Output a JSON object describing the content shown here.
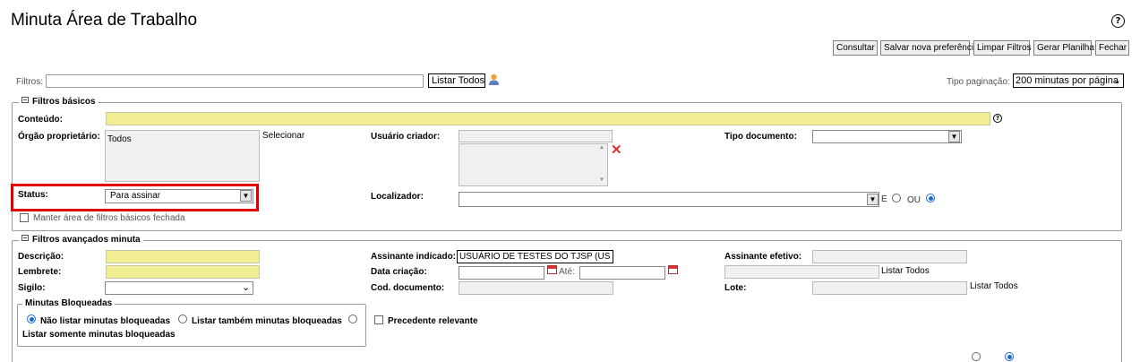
{
  "header": {
    "title": "Minuta Área de Trabalho",
    "help_glyph": "?"
  },
  "toolbar": {
    "consultar": "Consultar",
    "salvar": "Salvar nova preferência",
    "limpar": "Limpar Filtros",
    "gerar": "Gerar Planilha",
    "fechar": "Fechar"
  },
  "filters_bar": {
    "label": "Filtros:",
    "value": "",
    "listar_todos": "Listar Todos",
    "tipo_paginacao_label": "Tipo paginação:",
    "tipo_paginacao_value": "200 minutas por página"
  },
  "basic": {
    "legend": "Filtros básicos",
    "conteudo_label": "Conteúdo:",
    "orgao_label": "Órgão proprietário:",
    "orgao_value": "Todos",
    "selecionar": "Selecionar",
    "usuario_label": "Usuário criador:",
    "tipo_doc_label": "Tipo documento:",
    "status_label": "Status:",
    "status_value": "Para assinar",
    "localizador_label": "Localizador:",
    "e_label": "E",
    "ou_label": "OU",
    "manter_label": "Manter área de filtros básicos fechada"
  },
  "advanced": {
    "legend": "Filtros avançados minuta",
    "descricao_label": "Descrição:",
    "lembrete_label": "Lembrete:",
    "sigilo_label": "Sigilo:",
    "assinante_indicado_label": "Assinante indicado:",
    "assinante_indicado_value": "USUÁRIO DE TESTES DO TJSP (US",
    "data_criacao_label": "Data criação:",
    "ate_label": "Até:",
    "cod_documento_label": "Cod. documento:",
    "assinante_efetivo_label": "Assinante efetivo:",
    "listar_todos_1": "Listar Todos",
    "lote_label": "Lote:",
    "listar_todos_2": "Listar Todos",
    "bloqueadas_legend": "Minutas Bloqueadas",
    "nao_listar": "Não listar minutas bloqueadas",
    "listar_tambem": "Listar também minutas bloqueadas",
    "listar_somente": "Listar somente minutas bloqueadas",
    "precedente": "Precedente relevante"
  },
  "colors": {
    "yellow_field": "#f2ee93",
    "highlight_red": "#e00000",
    "radio_blue": "#1a6ad6"
  }
}
